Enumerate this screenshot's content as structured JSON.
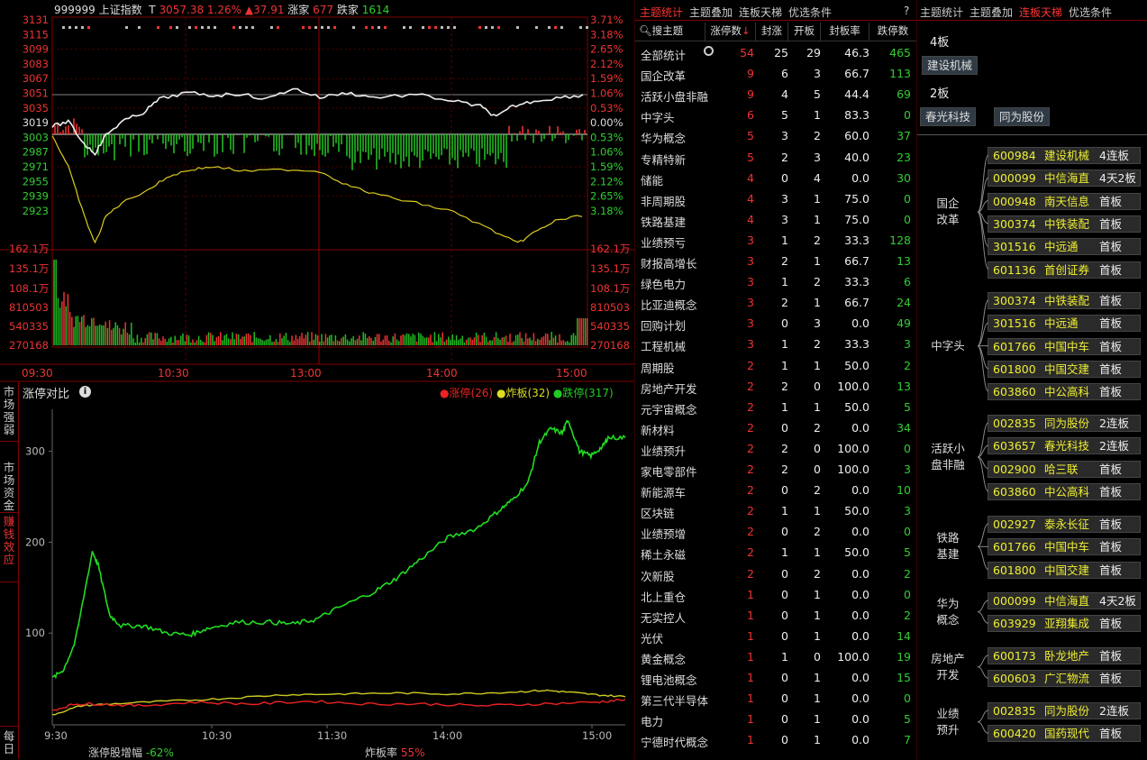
{
  "index_header": {
    "code": "999999",
    "name": "上证指数",
    "tag": "T",
    "price": "3057.38",
    "pct": "1.26%",
    "change": "▲37.91",
    "up_label": "涨家",
    "up_count": "677",
    "down_label": "跌家",
    "down_count": "1614"
  },
  "left_axis": [
    "3131",
    "3115",
    "3099",
    "3083",
    "3067",
    "3051",
    "3035",
    "3019",
    "3003",
    "2987",
    "2971",
    "2955",
    "2939",
    "2923"
  ],
  "right_axis": [
    "3.71%",
    "3.18%",
    "2.65%",
    "2.12%",
    "1.59%",
    "1.06%",
    "0.53%",
    "0.00%",
    "0.53%",
    "1.06%",
    "1.59%",
    "2.12%",
    "2.65%",
    "3.18%"
  ],
  "vol_left": [
    "162.1万",
    "135.1万",
    "108.1万",
    "810503",
    "540335",
    "270168"
  ],
  "vol_right": [
    "162.1万",
    "135.1万",
    "108.1万",
    "810503",
    "540335",
    "270168"
  ],
  "time_axis": [
    "09:30",
    "10:30",
    "13:00",
    "14:00",
    "15:00"
  ],
  "side_tabs": [
    "市场强弱",
    "市场资金",
    "赚钱效应",
    "每日"
  ],
  "compare": {
    "title": "涨停对比",
    "legend": [
      {
        "label": "涨停(26)",
        "color": "#ee2222"
      },
      {
        "label": "炸板(32)",
        "color": "#dddd22"
      },
      {
        "label": "跌停(317)",
        "color": "#22cc22"
      }
    ],
    "yticks": [
      "300",
      "200",
      "100"
    ],
    "xticks": [
      "9:30",
      "10:30",
      "11:30",
      "14:00",
      "15:00"
    ],
    "footer_left_label": "涨停股增幅",
    "footer_left_value": "-62%",
    "footer_right_label": "炸板率",
    "footer_right_value": "55%"
  },
  "mid_tabs": [
    "主题统计",
    "主题叠加",
    "连板天梯",
    "优选条件"
  ],
  "mid_help": "?",
  "table_headers": [
    "搜主题",
    "涨停数",
    "封涨",
    "开板",
    "封板率",
    "跌停数"
  ],
  "total_row": {
    "name": "全部统计",
    "a": "54",
    "b": "25",
    "c": "29",
    "d": "46.3",
    "e": "465"
  },
  "themes": [
    [
      "国企改革",
      "9",
      "6",
      "3",
      "66.7",
      "113"
    ],
    [
      "活跃小盘非融",
      "9",
      "4",
      "5",
      "44.4",
      "69"
    ],
    [
      "中字头",
      "6",
      "5",
      "1",
      "83.3",
      "0"
    ],
    [
      "华为概念",
      "5",
      "3",
      "2",
      "60.0",
      "37"
    ],
    [
      "专精特新",
      "5",
      "2",
      "3",
      "40.0",
      "23"
    ],
    [
      "储能",
      "4",
      "0",
      "4",
      "0.0",
      "30"
    ],
    [
      "非周期股",
      "4",
      "3",
      "1",
      "75.0",
      "0"
    ],
    [
      "铁路基建",
      "4",
      "3",
      "1",
      "75.0",
      "0"
    ],
    [
      "业绩预亏",
      "3",
      "1",
      "2",
      "33.3",
      "128"
    ],
    [
      "财报高增长",
      "3",
      "2",
      "1",
      "66.7",
      "13"
    ],
    [
      "绿色电力",
      "3",
      "1",
      "2",
      "33.3",
      "6"
    ],
    [
      "比亚迪概念",
      "3",
      "2",
      "1",
      "66.7",
      "24"
    ],
    [
      "回购计划",
      "3",
      "0",
      "3",
      "0.0",
      "49"
    ],
    [
      "工程机械",
      "3",
      "1",
      "2",
      "33.3",
      "3"
    ],
    [
      "周期股",
      "2",
      "1",
      "1",
      "50.0",
      "2"
    ],
    [
      "房地产开发",
      "2",
      "2",
      "0",
      "100.0",
      "13"
    ],
    [
      "元宇宙概念",
      "2",
      "1",
      "1",
      "50.0",
      "5"
    ],
    [
      "新材料",
      "2",
      "0",
      "2",
      "0.0",
      "34"
    ],
    [
      "业绩预升",
      "2",
      "2",
      "0",
      "100.0",
      "0"
    ],
    [
      "家电零部件",
      "2",
      "2",
      "0",
      "100.0",
      "3"
    ],
    [
      "新能源车",
      "2",
      "0",
      "2",
      "0.0",
      "10"
    ],
    [
      "区块链",
      "2",
      "1",
      "1",
      "50.0",
      "3"
    ],
    [
      "业绩预增",
      "2",
      "0",
      "2",
      "0.0",
      "0"
    ],
    [
      "稀土永磁",
      "2",
      "1",
      "1",
      "50.0",
      "5"
    ],
    [
      "次新股",
      "2",
      "0",
      "2",
      "0.0",
      "2"
    ],
    [
      "北上重仓",
      "1",
      "0",
      "1",
      "0.0",
      "0"
    ],
    [
      "无实控人",
      "1",
      "0",
      "1",
      "0.0",
      "2"
    ],
    [
      "光伏",
      "1",
      "0",
      "1",
      "0.0",
      "14"
    ],
    [
      "黄金概念",
      "1",
      "1",
      "0",
      "100.0",
      "19"
    ],
    [
      "锂电池概念",
      "1",
      "0",
      "1",
      "0.0",
      "15"
    ],
    [
      "第三代半导体",
      "1",
      "0",
      "1",
      "0.0",
      "0"
    ],
    [
      "电力",
      "1",
      "0",
      "1",
      "0.0",
      "5"
    ],
    [
      "宁德时代概念",
      "1",
      "0",
      "1",
      "0.0",
      "7"
    ]
  ],
  "right_tabs": [
    "主题统计",
    "主题叠加",
    "连板天梯",
    "优选条件"
  ],
  "ladder": [
    {
      "level": "4板",
      "stocks": [
        "建设机械"
      ]
    },
    {
      "level": "2板",
      "stocks": [
        "春光科技",
        "同为股份"
      ]
    }
  ],
  "groups": [
    {
      "name": [
        "国企",
        "改革"
      ],
      "stocks": [
        [
          "600984",
          "建设机械",
          "4连板"
        ],
        [
          "000099",
          "中信海直",
          "4天2板"
        ],
        [
          "000948",
          "南天信息",
          "首板"
        ],
        [
          "300374",
          "中铁装配",
          "首板"
        ],
        [
          "301516",
          "中远通",
          "首板"
        ],
        [
          "601136",
          "首创证券",
          "首板"
        ]
      ]
    },
    {
      "name": [
        "中字头"
      ],
      "stocks": [
        [
          "300374",
          "中铁装配",
          "首板"
        ],
        [
          "301516",
          "中远通",
          "首板"
        ],
        [
          "601766",
          "中国中车",
          "首板"
        ],
        [
          "601800",
          "中国交建",
          "首板"
        ],
        [
          "603860",
          "中公高科",
          "首板"
        ]
      ]
    },
    {
      "name": [
        "活跃小",
        "盘非融"
      ],
      "stocks": [
        [
          "002835",
          "同为股份",
          "2连板"
        ],
        [
          "603657",
          "春光科技",
          "2连板"
        ],
        [
          "002900",
          "哈三联",
          "首板"
        ],
        [
          "603860",
          "中公高科",
          "首板"
        ]
      ]
    },
    {
      "name": [
        "铁路",
        "基建"
      ],
      "stocks": [
        [
          "002927",
          "泰永长征",
          "首板"
        ],
        [
          "601766",
          "中国中车",
          "首板"
        ],
        [
          "601800",
          "中国交建",
          "首板"
        ]
      ]
    },
    {
      "name": [
        "华为",
        "概念"
      ],
      "stocks": [
        [
          "000099",
          "中信海直",
          "4天2板"
        ],
        [
          "603929",
          "亚翔集成",
          "首板"
        ]
      ]
    },
    {
      "name": [
        "房地产",
        "开发"
      ],
      "stocks": [
        [
          "600173",
          "卧龙地产",
          "首板"
        ],
        [
          "600603",
          "广汇物流",
          "首板"
        ]
      ]
    },
    {
      "name": [
        "业绩",
        "预升"
      ],
      "stocks": [
        [
          "002835",
          "同为股份",
          "2连板"
        ],
        [
          "600420",
          "国药现代",
          "首板"
        ]
      ]
    }
  ],
  "colors": {
    "up": "#ee3333",
    "down": "#33cc33",
    "accent_tab": "#ff3333",
    "stock_text": "#eeee33"
  }
}
